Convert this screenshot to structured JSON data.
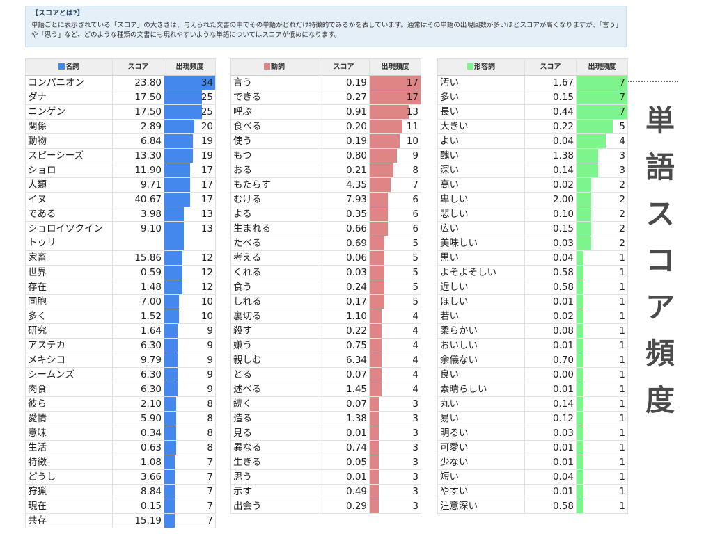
{
  "info": {
    "title": "【スコアとは?】",
    "body": "単語ごとに表示されている「スコア」の大きさは、与えられた文書の中でその単語がどれだけ特徴的であるかを表しています。通常はその単語の出現回数が多いほどスコアが高くなりますが、「言う」や「思う」など、どのような種類の文書にも現れやすいような単語についてはスコアが低めになります。"
  },
  "side_label": "単語スコア頻度",
  "side_chars": [
    "単",
    "語",
    "ス",
    "コ",
    "ア",
    "頻",
    "度"
  ],
  "colors": {
    "noun": "#4488ee",
    "verb": "#e08585",
    "adj": "#7ef58c"
  },
  "tables": [
    {
      "key": "noun",
      "headers": {
        "pos": "名詞",
        "score": "スコア",
        "freq": "出現頻度"
      },
      "max": 34,
      "rows": [
        {
          "word": "コンパニオン",
          "score": "23.80",
          "freq": 34
        },
        {
          "word": "ダナ",
          "score": "17.50",
          "freq": 25
        },
        {
          "word": "ニンゲン",
          "score": "17.50",
          "freq": 25
        },
        {
          "word": "関係",
          "score": "2.89",
          "freq": 20
        },
        {
          "word": "動物",
          "score": "6.84",
          "freq": 19
        },
        {
          "word": "スピーシーズ",
          "score": "13.30",
          "freq": 19
        },
        {
          "word": "ショロ",
          "score": "11.90",
          "freq": 17
        },
        {
          "word": "人類",
          "score": "9.71",
          "freq": 17
        },
        {
          "word": "イヌ",
          "score": "40.67",
          "freq": 17
        },
        {
          "word": "である",
          "score": "3.98",
          "freq": 13
        },
        {
          "word": "ショロイツクイントゥリ",
          "score": "9.10",
          "freq": 13,
          "tall": true
        },
        {
          "word": "家畜",
          "score": "15.86",
          "freq": 12
        },
        {
          "word": "世界",
          "score": "0.59",
          "freq": 12
        },
        {
          "word": "存在",
          "score": "1.48",
          "freq": 12
        },
        {
          "word": "同胞",
          "score": "7.00",
          "freq": 10
        },
        {
          "word": "多く",
          "score": "1.52",
          "freq": 10
        },
        {
          "word": "研究",
          "score": "1.64",
          "freq": 9
        },
        {
          "word": "アステカ",
          "score": "6.30",
          "freq": 9
        },
        {
          "word": "メキシコ",
          "score": "9.79",
          "freq": 9
        },
        {
          "word": "シームンズ",
          "score": "6.30",
          "freq": 9
        },
        {
          "word": "肉食",
          "score": "6.30",
          "freq": 9
        },
        {
          "word": "彼ら",
          "score": "2.10",
          "freq": 8
        },
        {
          "word": "愛情",
          "score": "5.90",
          "freq": 8
        },
        {
          "word": "意味",
          "score": "0.34",
          "freq": 8
        },
        {
          "word": "生活",
          "score": "0.63",
          "freq": 8
        },
        {
          "word": "特徴",
          "score": "1.08",
          "freq": 7
        },
        {
          "word": "どうし",
          "score": "3.66",
          "freq": 7
        },
        {
          "word": "狩猟",
          "score": "8.84",
          "freq": 7
        },
        {
          "word": "現在",
          "score": "0.15",
          "freq": 7
        },
        {
          "word": "共存",
          "score": "15.19",
          "freq": 7
        }
      ]
    },
    {
      "key": "verb",
      "headers": {
        "pos": "動詞",
        "score": "スコア",
        "freq": "出現頻度"
      },
      "max": 17,
      "rows": [
        {
          "word": "言う",
          "score": "0.19",
          "freq": 17
        },
        {
          "word": "できる",
          "score": "0.27",
          "freq": 17
        },
        {
          "word": "呼ぶ",
          "score": "0.91",
          "freq": 13
        },
        {
          "word": "食べる",
          "score": "0.20",
          "freq": 11
        },
        {
          "word": "使う",
          "score": "0.19",
          "freq": 10
        },
        {
          "word": "もつ",
          "score": "0.80",
          "freq": 9
        },
        {
          "word": "おる",
          "score": "0.21",
          "freq": 8
        },
        {
          "word": "もたらす",
          "score": "4.35",
          "freq": 7
        },
        {
          "word": "むける",
          "score": "7.93",
          "freq": 6
        },
        {
          "word": "よる",
          "score": "0.35",
          "freq": 6
        },
        {
          "word": "生まれる",
          "score": "0.66",
          "freq": 6
        },
        {
          "word": "たべる",
          "score": "0.69",
          "freq": 5
        },
        {
          "word": "考える",
          "score": "0.06",
          "freq": 5
        },
        {
          "word": "くれる",
          "score": "0.03",
          "freq": 5
        },
        {
          "word": "食う",
          "score": "0.24",
          "freq": 5
        },
        {
          "word": "しれる",
          "score": "0.17",
          "freq": 5
        },
        {
          "word": "裏切る",
          "score": "1.10",
          "freq": 4
        },
        {
          "word": "殺す",
          "score": "0.22",
          "freq": 4
        },
        {
          "word": "嫌う",
          "score": "0.75",
          "freq": 4
        },
        {
          "word": "親しむ",
          "score": "6.34",
          "freq": 4
        },
        {
          "word": "とる",
          "score": "0.07",
          "freq": 4
        },
        {
          "word": "述べる",
          "score": "1.45",
          "freq": 4
        },
        {
          "word": "続く",
          "score": "0.07",
          "freq": 3
        },
        {
          "word": "造る",
          "score": "1.38",
          "freq": 3
        },
        {
          "word": "見る",
          "score": "0.01",
          "freq": 3
        },
        {
          "word": "異なる",
          "score": "0.74",
          "freq": 3
        },
        {
          "word": "生きる",
          "score": "0.05",
          "freq": 3
        },
        {
          "word": "思う",
          "score": "0.01",
          "freq": 3
        },
        {
          "word": "示す",
          "score": "0.49",
          "freq": 3
        },
        {
          "word": "出会う",
          "score": "0.29",
          "freq": 3
        }
      ]
    },
    {
      "key": "adj",
      "headers": {
        "pos": "形容詞",
        "score": "スコア",
        "freq": "出現頻度"
      },
      "max": 7,
      "rows": [
        {
          "word": "汚い",
          "score": "1.67",
          "freq": 7
        },
        {
          "word": "多い",
          "score": "0.15",
          "freq": 7
        },
        {
          "word": "長い",
          "score": "0.44",
          "freq": 7
        },
        {
          "word": "大きい",
          "score": "0.22",
          "freq": 5
        },
        {
          "word": "よい",
          "score": "0.04",
          "freq": 4
        },
        {
          "word": "醜い",
          "score": "1.38",
          "freq": 3
        },
        {
          "word": "深い",
          "score": "0.14",
          "freq": 3
        },
        {
          "word": "高い",
          "score": "0.02",
          "freq": 2
        },
        {
          "word": "卑しい",
          "score": "2.00",
          "freq": 2
        },
        {
          "word": "悲しい",
          "score": "0.10",
          "freq": 2
        },
        {
          "word": "広い",
          "score": "0.15",
          "freq": 2
        },
        {
          "word": "美味しい",
          "score": "0.03",
          "freq": 2
        },
        {
          "word": "黒い",
          "score": "0.04",
          "freq": 1
        },
        {
          "word": "よそよそしい",
          "score": "0.58",
          "freq": 1
        },
        {
          "word": "近しい",
          "score": "0.58",
          "freq": 1
        },
        {
          "word": "ほしい",
          "score": "0.01",
          "freq": 1
        },
        {
          "word": "若い",
          "score": "0.02",
          "freq": 1
        },
        {
          "word": "柔らかい",
          "score": "0.08",
          "freq": 1
        },
        {
          "word": "おいしい",
          "score": "0.01",
          "freq": 1
        },
        {
          "word": "余儀ない",
          "score": "0.70",
          "freq": 1
        },
        {
          "word": "良い",
          "score": "0.00",
          "freq": 1
        },
        {
          "word": "素晴らしい",
          "score": "0.01",
          "freq": 1
        },
        {
          "word": "丸い",
          "score": "0.14",
          "freq": 1
        },
        {
          "word": "易い",
          "score": "0.12",
          "freq": 1
        },
        {
          "word": "明るい",
          "score": "0.03",
          "freq": 1
        },
        {
          "word": "可愛い",
          "score": "0.01",
          "freq": 1
        },
        {
          "word": "少ない",
          "score": "0.01",
          "freq": 1
        },
        {
          "word": "短い",
          "score": "0.04",
          "freq": 1
        },
        {
          "word": "やすい",
          "score": "0.01",
          "freq": 1
        },
        {
          "word": "注意深い",
          "score": "0.58",
          "freq": 1
        }
      ]
    }
  ]
}
